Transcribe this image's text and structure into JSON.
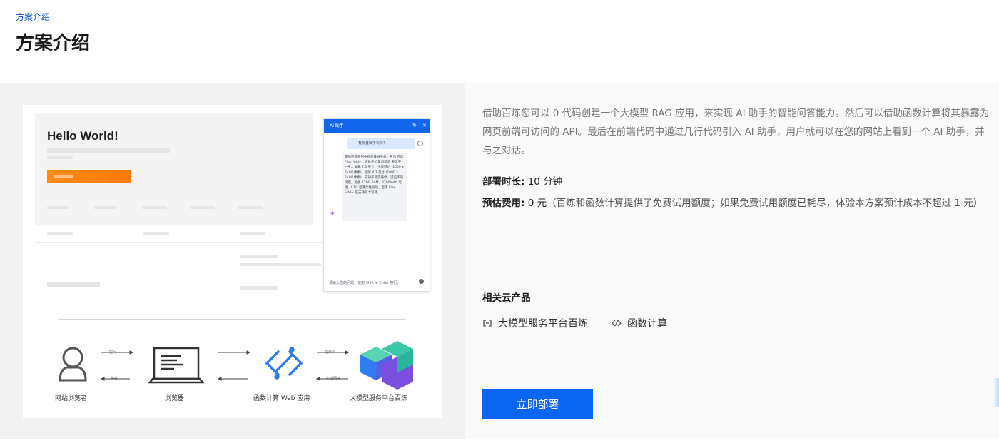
{
  "breadcrumb": "方案介绍",
  "page_title": "方案介绍",
  "preview": {
    "hello": "Hello World!",
    "chat_title": "AI 助手",
    "chat_question": "有折叠屏手机吗?",
    "chat_answer": "是的百炼系列中有折叠屏手机，名为 百炼 Flex Fold+。这款手机集创新与 奢华于一身。屏幕 7.6 英寸，主屏可达 (1600 x 2400 像素)；副屏 4.7 英寸 (1080 x 2400 像素)。支持多角度悬停，适应不同场景。配备 12GB RAM，4700mAh 电池，UTG 超薄柔性玻璃。百炼 Flex Fold+ 是支持双卡双待。",
    "chat_placeholder": "请输入您的问题，使用 Shift + Enter 换行。",
    "arch": {
      "nodes": [
        "网站浏览者",
        "浏览器",
        "函数计算 Web 应用",
        "大模型服务平台百炼"
      ],
      "arrows": [
        "提问",
        "答案",
        "提示词",
        "生成回答"
      ]
    }
  },
  "description": "借助百炼您可以 0 代码创建一个大模型 RAG 应用，来实现 AI 助手的智能问答能力。然后可以借助函数计算将其暴露为网页前端可访问的 API。最后在前端代码中通过几行代码引入 AI 助手，用户就可以在您的网站上看到一个 AI 助手，并与之对话。",
  "deploy_time": {
    "label": "部署时长:",
    "value": "10 分钟"
  },
  "cost": {
    "label": "预估费用:",
    "value": "0 元",
    "note": "（百炼和函数计算提供了免费试用额度；如果免费试用额度已耗尽，体验本方案预计成本不超过 1 元）"
  },
  "related": {
    "title": "相关云产品",
    "items": [
      {
        "label": "大模型服务平台百炼",
        "icon": "bailian-icon"
      },
      {
        "label": "函数计算",
        "icon": "function-compute-icon"
      }
    ]
  },
  "deploy_button": "立即部署"
}
